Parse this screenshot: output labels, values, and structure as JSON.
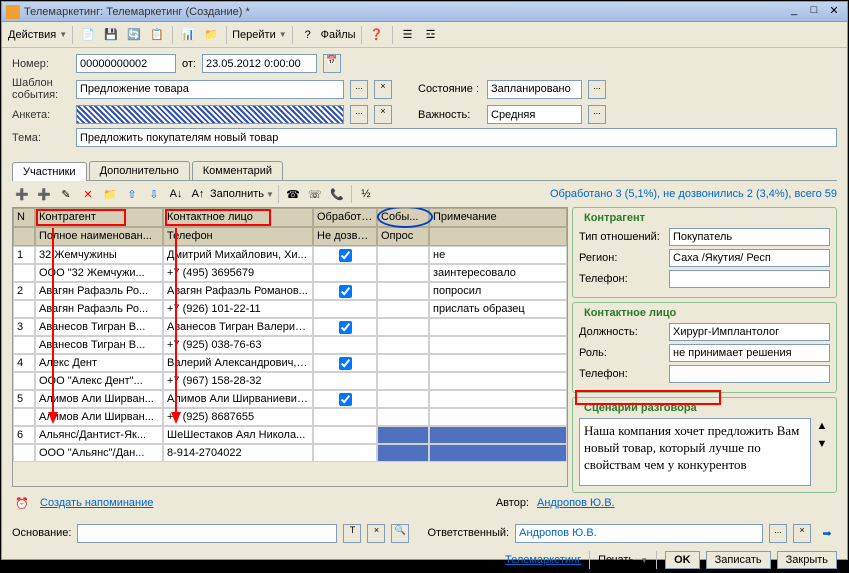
{
  "title": "Телемаркетинг: Телемаркетинг (Создание) *",
  "toolbar": {
    "actions": "Действия",
    "goto": "Перейти",
    "files": "Файлы"
  },
  "form": {
    "number_label": "Номер:",
    "number": "00000000002",
    "from_label": "от:",
    "date": "23.05.2012 0:00:00",
    "template_label": "Шаблон события:",
    "template": "Предложение товара",
    "survey_label": "Анкета:",
    "state_label": "Состояние :",
    "state": "Запланировано",
    "importance_label": "Важность:",
    "importance": "Средняя",
    "topic_label": "Тема:",
    "topic": "Предложить покупателям новый товар"
  },
  "tabs": {
    "t1": "Участники",
    "t2": "Дополнительно",
    "t3": "Комментарий"
  },
  "fill": "Заполнить",
  "status": "Обработано 3 (5,1%), не дозвонились 2 (3,4%), всего 59",
  "cols": {
    "n": "N",
    "contragent": "Контрагент",
    "contact": "Контактное лицо",
    "processed": "Обработан",
    "events": "Собы...",
    "note": "Примечание",
    "fullname": "Полное наименован...",
    "phone": "Телефон",
    "notreached": "Не дозвони...",
    "poll": "Опрос"
  },
  "rows": [
    {
      "n": "1",
      "c": "32 Жемчужины",
      "p": "Дмитрий Михайлович, Хи...",
      "ch1": true,
      "note": "не"
    },
    {
      "n": "",
      "c": "ООО \"32 Жемчужи...",
      "p": "+7 (495) 3695679",
      "note": "заинтересовало"
    },
    {
      "n": "2",
      "c": "Авагян Рафаэль Ро...",
      "p": "Авагян Рафаэль Романов...",
      "ch1": true,
      "note": "попросил"
    },
    {
      "n": "",
      "c": "Авагян Рафаэль Ро...",
      "p": "+7 (926) 101-22-11",
      "note": "прислать образец"
    },
    {
      "n": "3",
      "c": "Аванесов Тигран В...",
      "p": "Аванесов Тигран Валерие...",
      "ch1": true
    },
    {
      "n": "",
      "c": "Аванесов Тигран В...",
      "p": "+7 (925) 038-76-63"
    },
    {
      "n": "4",
      "c": "Алекс Дент",
      "p": "Валерий Александрович, Х...",
      "ch1": true
    },
    {
      "n": "",
      "c": "ООО \"Алекс Дент\"...",
      "p": "+7 (967) 158-28-32"
    },
    {
      "n": "5",
      "c": "Алимов Али Ширван...",
      "p": "Алимов Али  Ширваниевич...",
      "ch1": true
    },
    {
      "n": "",
      "c": "Алимов Али Ширван...",
      "p": "+7 (925) 8687655"
    },
    {
      "n": "6",
      "c": "Альянс/Дантист-Як...",
      "p": "ШеШестаков  Аял   Никола..."
    },
    {
      "n": "",
      "c": "ООО \"Альянс\"/Дан...",
      "p": "8-914-2704022"
    }
  ],
  "side": {
    "contragent": "Контрагент",
    "rel_type_l": "Тип отношений:",
    "rel_type": "Покупатель",
    "region_l": "Регион:",
    "region": "Саха /Якутия/ Респ",
    "phone_l": "Телефон:",
    "contact": "Контактное лицо",
    "position_l": "Должность:",
    "position": "Хирург-Имплантолог",
    "role_l": "Роль:",
    "role": "не принимает решения",
    "script": "Сценарий разговора",
    "script_text": "Наша компания хочет предложить Вам новый товар, который лучше по свойствам чем у конкурентов"
  },
  "footer": {
    "reminder": "Создать напоминание",
    "author_l": "Автор:",
    "author": "Андропов Ю.В.",
    "basis_l": "Основание:",
    "resp_l": "Ответственный:",
    "resp": "Андропов Ю.В.",
    "telemarketing": "Телемаркетинг",
    "print": "Печать",
    "ok": "OK",
    "save": "Записать",
    "close": "Закрыть"
  }
}
